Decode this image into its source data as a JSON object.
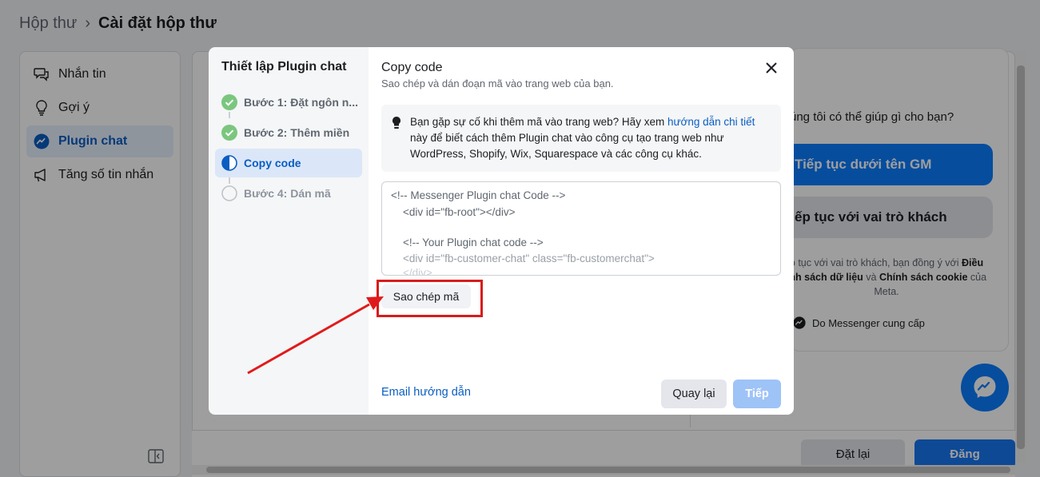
{
  "breadcrumb": {
    "parent": "Hộp thư",
    "current": "Cài đặt hộp thư"
  },
  "nav": [
    {
      "label": "Nhắn tin",
      "icon": "chat-bubbles-icon"
    },
    {
      "label": "Gợi ý",
      "icon": "lightbulb-icon"
    },
    {
      "label": "Plugin chat",
      "icon": "messenger-icon",
      "active": true
    },
    {
      "label": "Tăng số tin nhắn",
      "icon": "megaphone-icon"
    }
  ],
  "preview": {
    "question": "úng tôi có thể giúp gì cho bạn?",
    "continue_name": "Tiếp tục dưới tên GM",
    "continue_guest": "ếp tục với vai trò khách",
    "consent_1": "p tục với vai trò khách, bạn đồng ý với",
    "consent_bold_1": "Điều",
    "consent_2_bold": "ính sách dữ liệu",
    "consent_and": "và",
    "consent_bold_2": "Chính sách cookie",
    "consent_of": "của",
    "consent_3": "Meta.",
    "powered_by": "Do Messenger cung cấp"
  },
  "footer": {
    "reset_label": "Đặt lại",
    "post_label": "Đăng"
  },
  "modal": {
    "left_title": "Thiết lập Plugin chat",
    "steps": [
      {
        "label": "Bước 1: Đặt ngôn n...",
        "state": "done"
      },
      {
        "label": "Bước 2: Thêm miền",
        "state": "done"
      },
      {
        "label": "Copy code",
        "state": "current"
      },
      {
        "label": "Bước 4: Dán mã",
        "state": "todo"
      }
    ],
    "title": "Copy code",
    "subtitle": "Sao chép và dán đoạn mã vào trang web của bạn.",
    "tip_prefix": "Bạn gặp sự cố khi thêm mã vào trang web? Hãy xem",
    "tip_link": "hướng dẫn chi tiết",
    "tip_suffix": "này để biết cách thêm Plugin chat vào công cụ tạo trang web như WordPress, Shopify, Wix, Squarespace và các công cụ khác.",
    "code_lines": [
      "<!-- Messenger Plugin chat Code -->",
      "    <div id=\"fb-root\"></div>",
      "",
      "    <!-- Your Plugin chat code -->",
      "    <div id=\"fb-customer-chat\" class=\"fb-customerchat\">",
      "    </div>"
    ],
    "copy_button": "Sao chép mã",
    "email_link": "Email hướng dẫn",
    "back_button": "Quay lại",
    "next_button": "Tiếp"
  },
  "colors": {
    "accent": "#0a7cff",
    "highlight": "#d81c1c"
  }
}
